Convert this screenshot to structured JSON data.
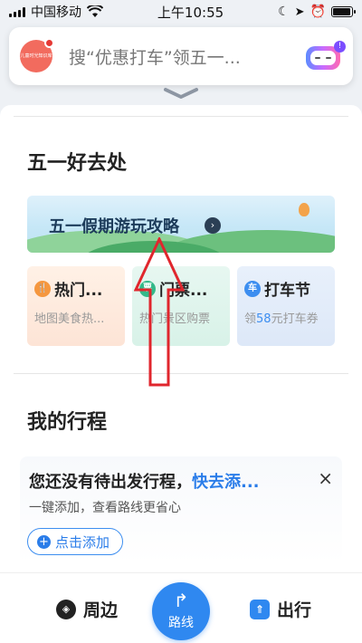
{
  "status_bar": {
    "carrier": "中国移动",
    "time": "上午10:55",
    "battery_level": 0.95
  },
  "search": {
    "placeholder": "搜“优惠打车”领五一...",
    "avatar_text": "儿童时光知识库",
    "robot_badge": "!"
  },
  "travel_section": {
    "title": "五一好去处",
    "banner_text": "五一假期游玩攻略",
    "banner_arrow": "›",
    "cards": [
      {
        "icon": "🍴",
        "title": "热门...",
        "subtitle": "地图美食热..."
      },
      {
        "icon": "票",
        "title": "门票...",
        "subtitle": "热门景区购票"
      },
      {
        "icon": "车",
        "title": "打车节",
        "subtitle_pre": "领",
        "subtitle_hl": "58",
        "subtitle_post": "元打车券"
      }
    ]
  },
  "trips_section": {
    "title": "我的行程",
    "empty_text": "您还没有待出发行程，",
    "empty_link": "快去添...",
    "close": "×",
    "subtitle": "一键添加，查看路线更省心",
    "add_button": "点击添加",
    "add_icon": "+"
  },
  "bottom_nav": {
    "nearby": "周边",
    "route": "路线",
    "travel": "出行"
  },
  "colors": {
    "accent": "#2f88f0",
    "annotation": "#e0262d"
  }
}
